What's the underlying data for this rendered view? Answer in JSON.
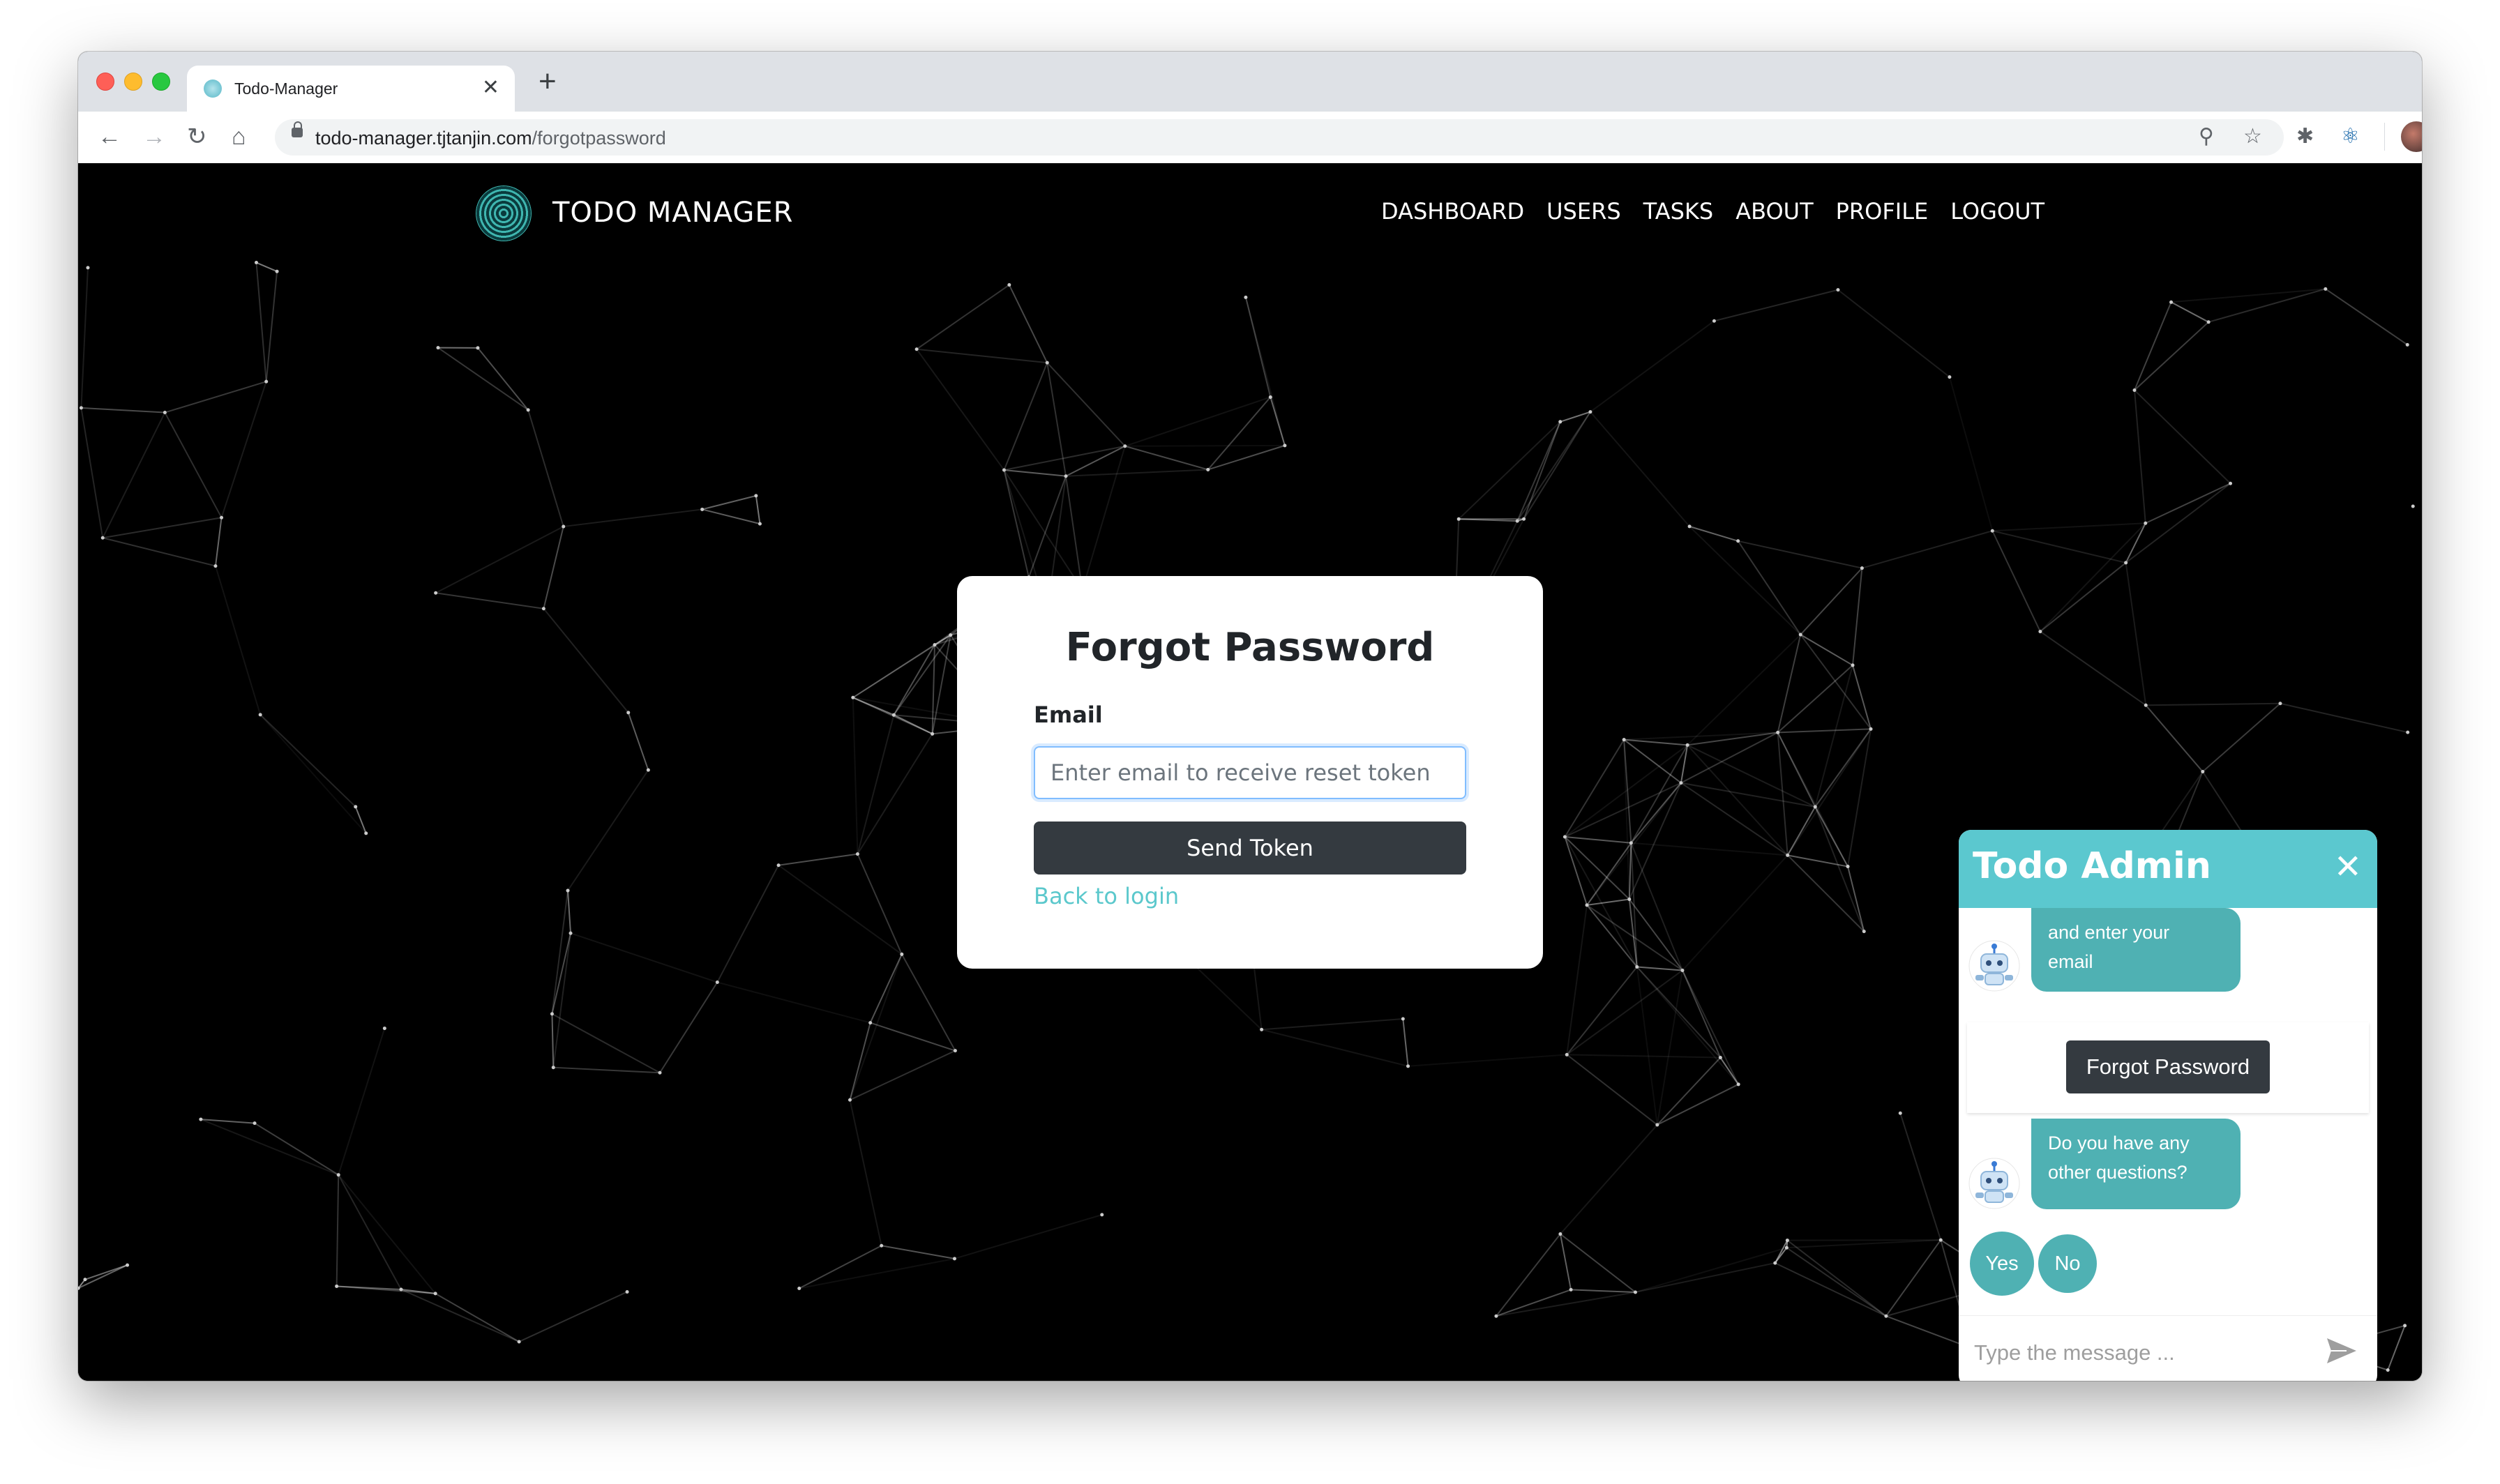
{
  "browser": {
    "tab_title": "Todo-Manager",
    "tab_close": "✕",
    "new_tab": "+",
    "url_domain": "todo-manager.tjtanjin.com",
    "url_path": "/forgotpassword"
  },
  "navbar": {
    "brand": "TODO MANAGER",
    "links": [
      "DASHBOARD",
      "USERS",
      "TASKS",
      "ABOUT",
      "PROFILE",
      "LOGOUT"
    ]
  },
  "form": {
    "title": "Forgot Password",
    "email_label": "Email",
    "email_placeholder": "Enter email to receive reset token",
    "email_value": "",
    "submit_label": "Send Token",
    "back_link": "Back to login"
  },
  "chat": {
    "title": "Todo Admin",
    "close": "✕",
    "message1_line1": "and enter your",
    "message1_line2": "email",
    "suggestion_button": "Forgot Password",
    "message2_line1": "Do you have any",
    "message2_line2": "other questions?",
    "yes_label": "Yes",
    "no_label": "No",
    "input_placeholder": "Type the message ..."
  },
  "colors": {
    "accent": "#5bc8cf",
    "bubble": "#4fb1b3",
    "dark_button": "#343a40"
  }
}
